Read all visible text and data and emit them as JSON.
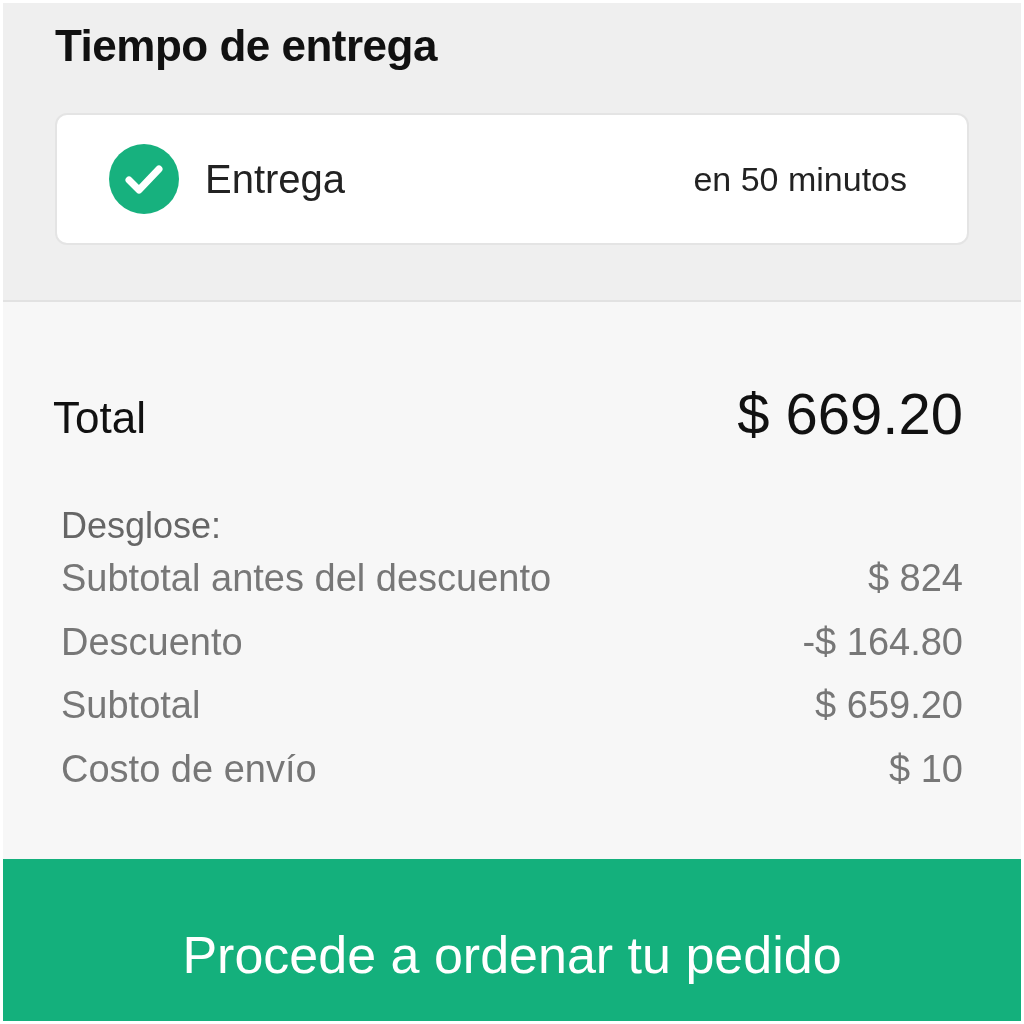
{
  "delivery": {
    "title": "Tiempo de entrega",
    "option": {
      "label": "Entrega",
      "time": "en 50 minutos",
      "checked": true
    }
  },
  "total": {
    "label": "Total",
    "amount": "$ 669.20"
  },
  "breakdown": {
    "title": "Desglose:",
    "rows": [
      {
        "label": "Subtotal antes del descuento",
        "value": "$ 824"
      },
      {
        "label": "Descuento",
        "value": "-$ 164.80"
      },
      {
        "label": "Subtotal",
        "value": "$ 659.20"
      },
      {
        "label": "Costo de envío",
        "value": "$ 10"
      }
    ]
  },
  "order_button": {
    "label": "Procede a ordenar tu pedido"
  }
}
